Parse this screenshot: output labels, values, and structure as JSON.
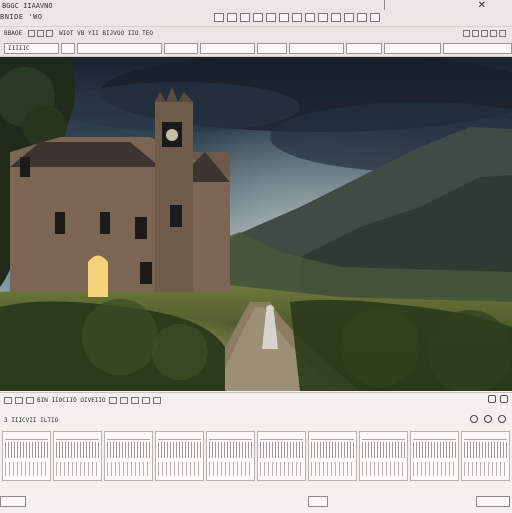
{
  "window": {
    "title": "BGGC IIAAVNO",
    "subtitle": "BNIDE 'WO",
    "close_icon": "close-icon"
  },
  "toolbar": {
    "label_left": "BBAOE",
    "label_mid": "WIOT VB YII BIJVOO IIO TEO",
    "fields": [
      "IIIIIC",
      "",
      "",
      "",
      "",
      "",
      "",
      "",
      ""
    ]
  },
  "canvas": {
    "alt": "Stone manor with clock tower in a green valley beneath stormy sky, a cloaked figure on a dirt path"
  },
  "bottom": {
    "status": "BIN IIOCIIO ΩIVEIIO",
    "info": "3 IIICVII ILTIO",
    "right_icons": [
      "sync-icon",
      "settings-icon",
      "record-icon",
      "save-icon"
    ]
  },
  "colors": {
    "chrome": "#e9e7e3",
    "border": "#cfcac3",
    "sky_dark": "#1c2330",
    "sky_light": "#9fb7c5",
    "grass": "#4f6a2c"
  }
}
